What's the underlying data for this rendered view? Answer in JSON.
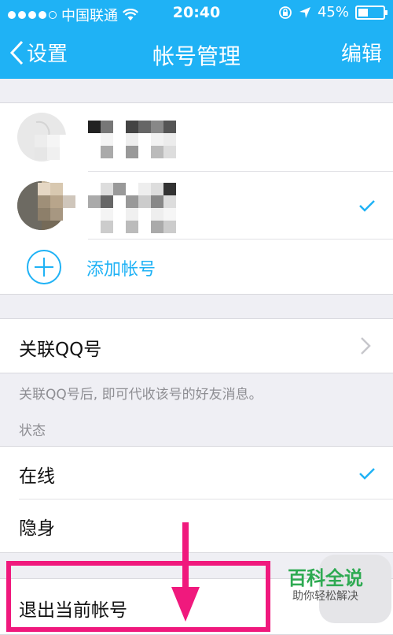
{
  "status_bar": {
    "carrier": "中国联通",
    "time": "20:40",
    "battery": "45%"
  },
  "nav": {
    "back_label": "设置",
    "title": "帐号管理",
    "edit_label": "编辑"
  },
  "accounts": {
    "add_label": "添加帐号"
  },
  "linked": {
    "label": "关联QQ号",
    "hint": "关联QQ号后, 即可代收该号的好友消息。"
  },
  "status_section": {
    "header": "状态",
    "options": [
      {
        "label": "在线",
        "selected": true
      },
      {
        "label": "隐身",
        "selected": false
      }
    ]
  },
  "logout": {
    "label": "退出当前帐号"
  },
  "watermark": {
    "title": "百科全说",
    "subtitle": "助你轻松解决"
  },
  "colors": {
    "accent": "#1fb2f5",
    "highlight": "#f0197d"
  }
}
